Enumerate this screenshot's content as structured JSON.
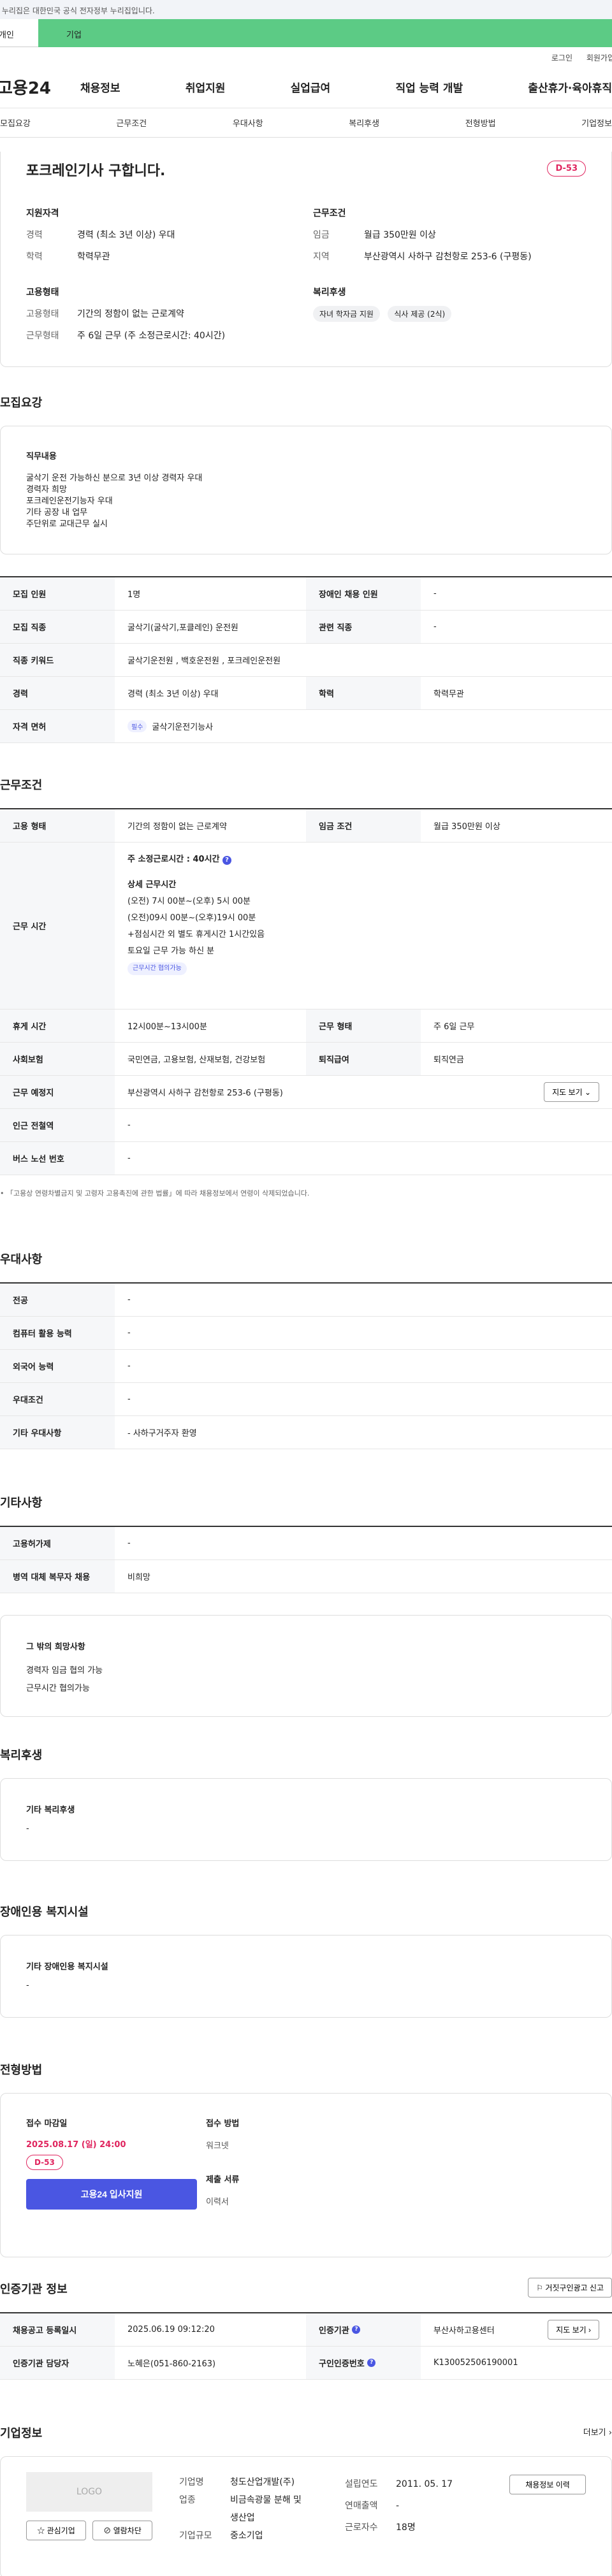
{
  "gov_banner": "이 누리집은 대한민국 공식 전자정부 누리집입니다.",
  "tabs": [
    "개인",
    "기업"
  ],
  "util": [
    "로그인",
    "회원가입"
  ],
  "site_logo": "고용24",
  "gnb": [
    "채용정보",
    "취업지원",
    "실업급여",
    "직업 능력 개발",
    "출산휴가·육아휴직"
  ],
  "subnav": [
    "모집요강",
    "근무조건",
    "우대사항",
    "복리후생",
    "전형방법",
    "기업정보"
  ],
  "summary": {
    "title": "포크레인기사 구합니다.",
    "dday": "D-53",
    "qual_title": "지원자격",
    "qual": [
      {
        "k": "경력",
        "v": "경력 (최소 3년 이상) 우대"
      },
      {
        "k": "학력",
        "v": "학력무관"
      }
    ],
    "cond_title": "근무조건",
    "cond": [
      {
        "k": "임금",
        "v": "월급 350만원 이상"
      },
      {
        "k": "지역",
        "v": "부산광역시 사하구 감천항로 253-6 (구평동)"
      }
    ],
    "emp_title": "고용형태",
    "emp": [
      {
        "k": "고용형태",
        "v": "기간의 정함이 없는 근로계약"
      },
      {
        "k": "근무형태",
        "v": "주 6일 근무 (주 소정근로시간: 40시간)"
      }
    ],
    "welfare_title": "복리후생",
    "welfare_tags": [
      "자녀 학자금 지원",
      "식사 제공 (2식)"
    ]
  },
  "recruit": {
    "title": "모집요강",
    "duty_title": "직무내용",
    "duty_lines": [
      "굴삭기 운전 가능하신 분으로 3년 이상 경력자 우대",
      "경력자 희망",
      "포크레인운전기능자 우대",
      "기타 공장 내 업무",
      "주단위로 교대근무 실시"
    ],
    "rows": [
      {
        "l1": "모집 인원",
        "v1": "1명",
        "l2": "장애인 채용 인원",
        "v2": "-"
      },
      {
        "l1": "모집 직종",
        "v1": "굴삭기(굴삭기,포클레인) 운전원",
        "l2": "관련 직종",
        "v2": "-"
      },
      {
        "l1": "직종 키워드",
        "v1": "굴삭기운전원 , 백호운전원 , 포크레인운전원",
        "l2": "",
        "v2": ""
      },
      {
        "l1": "경력",
        "v1": "경력 (최소 3년 이상) 우대",
        "l2": "학력",
        "v2": "학력무관"
      },
      {
        "l1": "자격 면허",
        "v1": "굴삭기운전기능사",
        "l2": "",
        "v2": ""
      }
    ],
    "req_tag": "필수"
  },
  "work": {
    "title": "근무조건",
    "emp_label": "고용 형태",
    "emp_value": "기간의 정함이 없는 근로계약",
    "wage_label": "임금 조건",
    "wage_value": "월급 350만원 이상",
    "time_label": "근무 시간",
    "time_main": "주 소정근로시간 : 40시간",
    "time_detail_title": "상세 근무시간",
    "time_lines": [
      "(오전) 7시 00분~(오후) 5시 00분",
      "(오전)09시 00분~(오후)19시 00분",
      "+점심시간 외 별도 휴게시간 1시간있음",
      "토요일 근무 가능 하신 분"
    ],
    "time_tag": "근무시간 협의가능",
    "rest_label": "휴게 시간",
    "rest_value": "12시00분~13시00분",
    "shift_label": "근무 형태",
    "shift_value": "주 6일 근무",
    "ins_label": "사회보험",
    "ins_value": "국민연금, 고용보험, 산재보험, 건강보험",
    "ret_label": "퇴직급여",
    "ret_value": "퇴직연금",
    "place_label": "근무 예정지",
    "place_value": "부산광역시 사하구 감천항로 253-6 (구평동)",
    "map_btn": "지도 보기",
    "station_label": "인근 전철역",
    "station_value": "-",
    "bus_label": "버스 노선 번호",
    "bus_value": "-",
    "note": "「고용상 연령차별금지 및 고령자 고용촉진에 관한 법률」에 따라 채용정보에서 연령이 삭제되었습니다."
  },
  "pref": {
    "title": "우대사항",
    "rows": [
      {
        "k": "전공",
        "v": "-"
      },
      {
        "k": "컴퓨터 활용 능력",
        "v": "-"
      },
      {
        "k": "외국어 능력",
        "v": "-"
      },
      {
        "k": "우대조건",
        "v": "-"
      },
      {
        "k": "기타 우대사항",
        "v": "- 사하구거주자 환영"
      }
    ]
  },
  "etc": {
    "title": "기타사항",
    "rows": [
      {
        "k": "고용허가제",
        "v": "-"
      },
      {
        "k": "병역 대체 복무자 채용",
        "v": "비희망"
      }
    ],
    "wish_title": "그 밖의 희망사항",
    "wish_lines": [
      "경력자 임금 협의 가능",
      "근무시간 협의가능"
    ]
  },
  "welfare": {
    "title": "복리후생",
    "box_title": "기타 복리후생",
    "box_value": "-"
  },
  "facility": {
    "title": "장애인용 복지시설",
    "box_title": "기타 장애인용 복지시설",
    "box_value": "-"
  },
  "process": {
    "title": "전형방법",
    "deadline_label": "접수 마감일",
    "deadline_value": "2025.08.17 (일) 24:00",
    "dday": "D-53",
    "apply_btn": "고용24 입사지원",
    "method_label": "접수 방법",
    "method_value": "워크넷",
    "docs_label": "제출 서류",
    "docs_value": "이력서"
  },
  "cert": {
    "title": "인증기관 정보",
    "report_btn": "거짓구인광고 신고",
    "reg_label": "채용공고 등록일시",
    "reg_value": "2025.06.19 09:12:20",
    "org_label": "인증기관",
    "org_value": "부산사하고용센터",
    "map_btn": "지도 보기",
    "manager_label": "인증기관 담당자",
    "manager_value": "노혜은(051-860-2163)",
    "no_label": "구인인증번호",
    "no_value": "K130052506190001"
  },
  "company": {
    "title": "기업정보",
    "more": "더보기",
    "logo": "LOGO",
    "interest_btn": "관심기업",
    "block_btn": "열람차단",
    "name_label": "기업명",
    "name_value": "청도산업개발(주)",
    "ind_label": "업종",
    "ind_value": "비금속광물 분해 및 생산업",
    "size_label": "기업규모",
    "size_value": "중소기업",
    "est_label": "설립연도",
    "est_value": "2011. 05. 17",
    "sales_label": "연매출액",
    "sales_value": "-",
    "emp_label": "근로자수",
    "emp_value": "18명",
    "jobs_btn": "채용정보 이력"
  }
}
